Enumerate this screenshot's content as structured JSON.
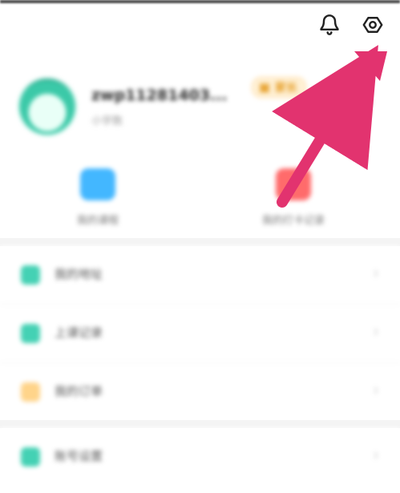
{
  "profile": {
    "username": "zwp11281403...",
    "sublabel": "小学数",
    "role_badge": "家长"
  },
  "quick_actions": [
    {
      "label": "我的课程",
      "color": "#43b7ff"
    },
    {
      "label": "我的打卡记录",
      "color": "#ff6b6b"
    }
  ],
  "list_section_1": [
    {
      "label": "我的地址",
      "color": "#44d1b4"
    },
    {
      "label": "上课记录",
      "color": "#44d1b4"
    },
    {
      "label": "我的订单",
      "color": "#ffd48a"
    }
  ],
  "list_section_2": [
    {
      "label": "账号设置",
      "color": "#44d1b4"
    }
  ],
  "icons": {
    "bell": "bell-icon",
    "settings": "settings-icon",
    "chevron": "chevron-right-icon"
  },
  "colors": {
    "annotation_arrow": "#e2336f"
  }
}
